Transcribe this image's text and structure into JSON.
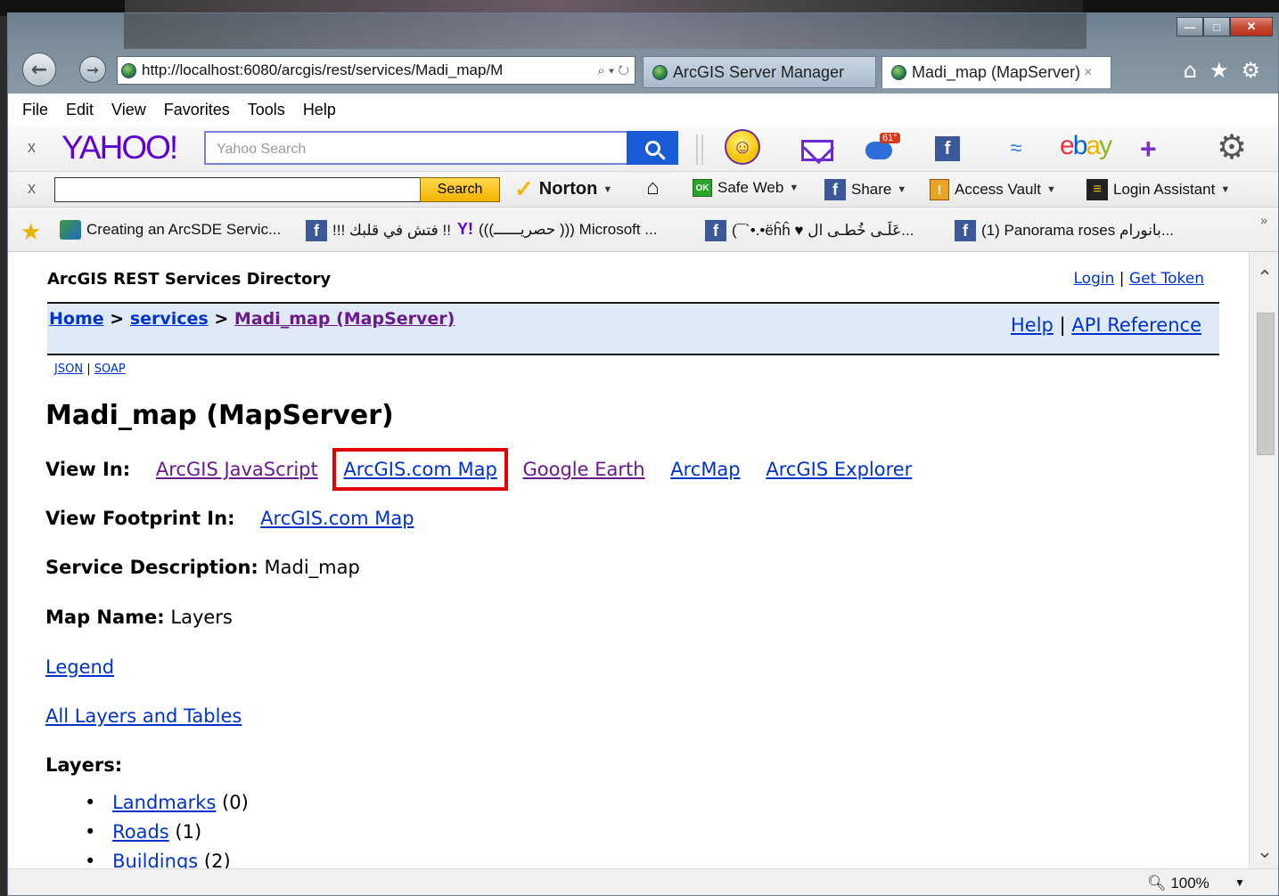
{
  "browser": {
    "address": "http://localhost:6080/arcgis/rest/services/Madi_map/M",
    "address_tools": "⌕ ▾ ↻",
    "tabs": [
      {
        "label": "ArcGIS Server Manager",
        "close": ""
      },
      {
        "label": "Madi_map (MapServer)",
        "close": "×"
      }
    ],
    "window_controls": {
      "minimize": "—",
      "maximize": "□",
      "close": "✕"
    },
    "right_tools": {
      "home": "⌂",
      "favorites": "★",
      "settings": "⚙"
    }
  },
  "menu": [
    "File",
    "Edit",
    "View",
    "Favorites",
    "Tools",
    "Help"
  ],
  "yahoo_toolbar": {
    "close": "x",
    "logo": "YAHOO!",
    "search_placeholder": "Yahoo Search",
    "weather_badge": "61°",
    "facebook": "f",
    "plus": "+",
    "gear": "⚙"
  },
  "norton_toolbar": {
    "close": "x",
    "search_button": "Search",
    "norton": "Norton",
    "home": "⌂",
    "safe_web_badge": "OK",
    "safe_web": "Safe Web",
    "share": "Share",
    "access_vault": "Access Vault",
    "login_assistant": "Login Assistant"
  },
  "favorites": {
    "items": [
      "Creating an ArcSDE Servic...",
      "!!! فتش في قلبك !!",
      "(((حصريــــــ ))) Microsoft ...",
      "(¯`•.•ëĥĥ ♥ عَلَـى خُطـى ال...",
      "(1) Panorama roses بانورام..."
    ],
    "more": "»"
  },
  "page": {
    "directory_title": "ArcGIS REST Services Directory",
    "login": "Login",
    "get_token": "Get Token",
    "breadcrumb": {
      "home": "Home",
      "services": "services",
      "current": "Madi_map (MapServer)",
      "sep": ">"
    },
    "help": "Help",
    "api_reference": "API Reference",
    "json": "JSON",
    "soap": "SOAP",
    "service_title": "Madi_map (MapServer)",
    "view_in_label": "View In:",
    "view_in_links": [
      "ArcGIS JavaScript",
      "ArcGIS.com Map",
      "Google Earth",
      "ArcMap",
      "ArcGIS Explorer"
    ],
    "footprint_label": "View Footprint In:",
    "footprint_link": "ArcGIS.com Map",
    "service_description_label": "Service Description:",
    "service_description": "Madi_map",
    "map_name_label": "Map Name:",
    "map_name": "Layers",
    "legend": "Legend",
    "all_layers": "All Layers and Tables",
    "layers_label": "Layers:",
    "layers": [
      {
        "name": "Landmarks",
        "id": "(0)"
      },
      {
        "name": "Roads",
        "id": "(1)"
      },
      {
        "name": "Buildings",
        "id": "(2)"
      }
    ]
  },
  "status": {
    "zoom": "100%"
  }
}
